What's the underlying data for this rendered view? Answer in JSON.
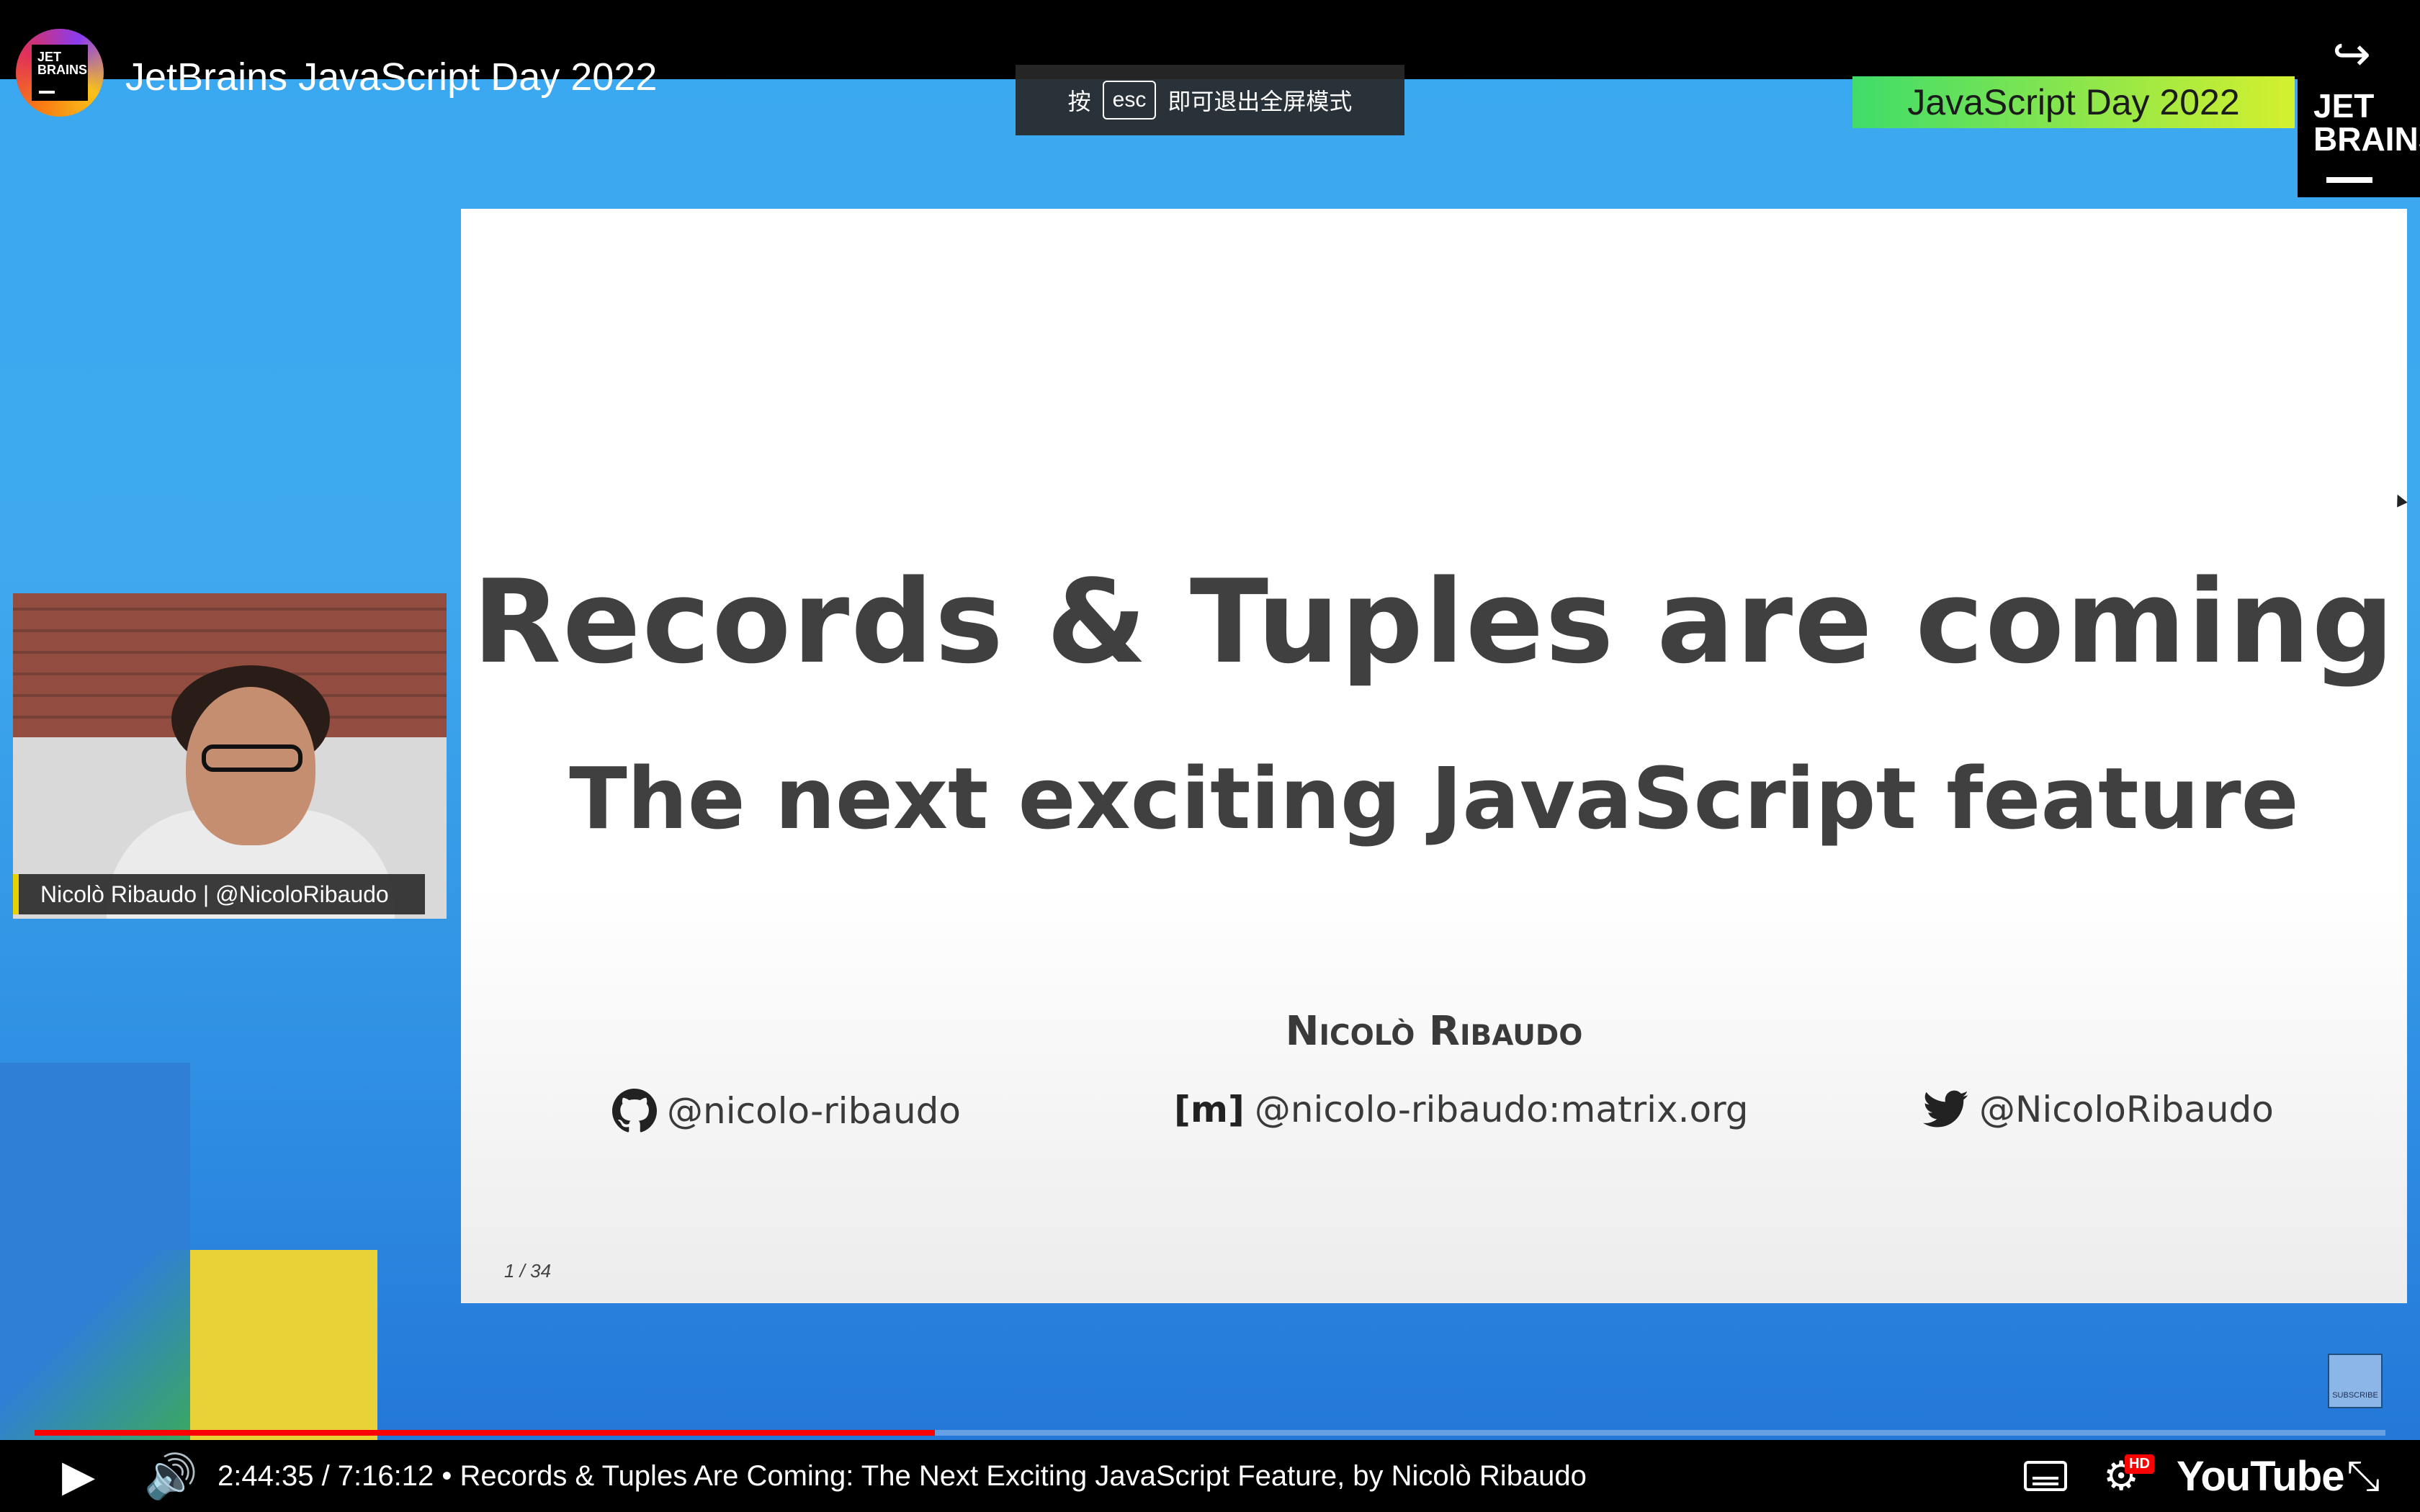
{
  "window": {
    "title": "JetBrains JavaScript Day 2022",
    "channel_logo_text": "JET\nBRAINS",
    "share_label": "分享"
  },
  "toast": {
    "before": "按",
    "key": "esc",
    "after": "即可退出全屏模式"
  },
  "overlay": {
    "badge": "JavaScript Day 2022",
    "jetbrains_logo": "JET\nBRAINS"
  },
  "slide": {
    "title": "Records & Tuples are coming",
    "subtitle": "The next exciting JavaScript feature",
    "author": "Nicolò Ribaudo",
    "github": "@nicolo-ribaudo",
    "matrix": "@nicolo-ribaudo:matrix.org",
    "twitter": "@NicoloRibaudo",
    "page": "1 / 34"
  },
  "webcam": {
    "nametag": "Nicolò Ribaudo | @NicoloRibaudo"
  },
  "subscribe": "SUBSCRIBE",
  "player": {
    "time_current": "2:44:35",
    "time_total": "7:16:12",
    "chapter": "Records & Tuples Are Coming: The Next Exciting JavaScript Feature, by Nicolò Ribaudo",
    "timeline_text": "2:44:35 / 7:16:12 • Records & Tuples Are Coming: The Next Exciting JavaScript Feature, by Nicolò Ribaudo",
    "progress_fraction": 0.383,
    "brand": "YouTube",
    "hd_badge": "HD"
  },
  "icons": {
    "play": "play-icon",
    "volume": "volume-icon",
    "captions": "captions-icon",
    "settings": "settings-icon",
    "fullscreen": "exit-fullscreen-icon",
    "share": "share-icon"
  }
}
